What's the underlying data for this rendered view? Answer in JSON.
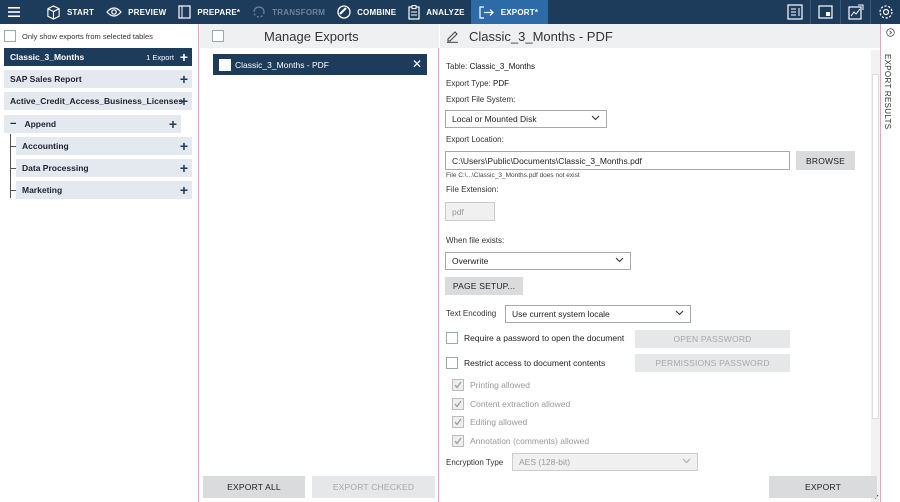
{
  "topbar": {
    "items": [
      {
        "label": "START",
        "icon": "cube-icon"
      },
      {
        "label": "PREVIEW",
        "icon": "eye-icon"
      },
      {
        "label": "PREPARE*",
        "icon": "prepare-icon"
      },
      {
        "label": "TRANSFORM",
        "icon": "transform-icon"
      },
      {
        "label": "COMBINE",
        "icon": "combine-icon"
      },
      {
        "label": "ANALYZE",
        "icon": "clipboard-icon"
      },
      {
        "label": "EXPORT*",
        "icon": "export-arrow-icon"
      }
    ]
  },
  "left": {
    "only_show": "Only show exports from selected tables",
    "items": [
      {
        "label": "Classic_3_Months",
        "count": "1 Export"
      },
      {
        "label": "SAP Sales Report"
      },
      {
        "label": "Active_Credit_Access_Business_Licenses"
      },
      {
        "label": "Append",
        "prefix": "−"
      },
      {
        "label": "Accounting"
      },
      {
        "label": "Data Processing"
      },
      {
        "label": "Marketing"
      }
    ],
    "plus": "+"
  },
  "middle": {
    "title": "Manage Exports",
    "export_item": "Classic_3_Months - PDF",
    "close": "✕",
    "export_all": "EXPORT ALL",
    "export_checked": "EXPORT CHECKED"
  },
  "right": {
    "title": "Classic_3_Months - PDF",
    "table_label": "Table:",
    "table_value": "Classic_3_Months",
    "type_label": "Export Type:",
    "type_value": "PDF",
    "fs_label": "Export File System:",
    "fs_value": "Local or Mounted Disk",
    "loc_label": "Export Location:",
    "loc_value": "C:\\Users\\Public\\Documents\\Classic_3_Months.pdf",
    "browse": "BROWSE",
    "loc_note": "File C:\\...\\Classic_3_Months.pdf does not exist",
    "ext_label": "File Extension:",
    "ext_value": "pdf",
    "exists_label": "When file exists:",
    "exists_value": "Overwrite",
    "page_setup": "PAGE SETUP...",
    "encoding_label": "Text Encoding",
    "encoding_value": "Use current system locale",
    "require_pw": "Require a password to open the document",
    "open_pw": "OPEN PASSWORD",
    "restrict": "Restrict access to document contents",
    "perm_pw": "PERMISSIONS PASSWORD",
    "printing": "Printing allowed",
    "content_ext": "Content extraction allowed",
    "editing": "Editing allowed",
    "annotation": "Annotation (comments) allowed",
    "enc_type_label": "Encryption Type",
    "enc_type_value": "AES (128-bit)",
    "export": "EXPORT"
  },
  "results": {
    "label": "EXPORT RESULTS"
  }
}
